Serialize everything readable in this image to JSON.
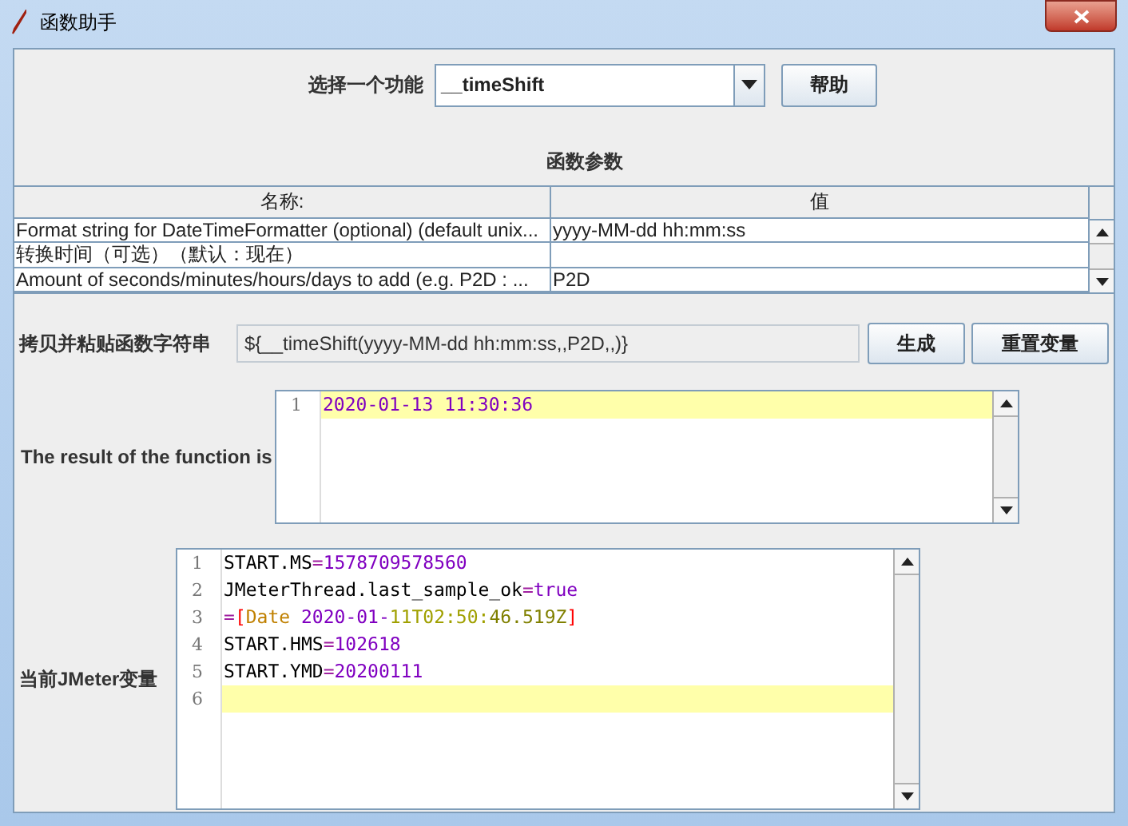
{
  "window": {
    "title": "函数助手"
  },
  "function_select": {
    "label": "选择一个功能",
    "value": "__timeShift",
    "help_button": "帮助"
  },
  "parameters": {
    "title": "函数参数",
    "columns": [
      "名称:",
      "值"
    ],
    "rows": [
      {
        "name": "Format string for DateTimeFormatter (optional) (default unix...",
        "value": "yyyy-MM-dd hh:mm:ss"
      },
      {
        "name": "转换时间（可选）（默认：现在）",
        "value": ""
      },
      {
        "name": "Amount of seconds/minutes/hours/days to add (e.g. P2D : ...",
        "value": "P2D"
      }
    ]
  },
  "copy_string": {
    "label": "拷贝并粘贴函数字符串",
    "value": "${__timeShift(yyyy-MM-dd hh:mm:ss,,P2D,,)}",
    "generate_button": "生成",
    "reset_button": "重置变量"
  },
  "result": {
    "label": "The result of the function is",
    "lines": [
      {
        "number": "1",
        "current": true,
        "tokens": [
          {
            "text": "2020-01-13 11:30:36",
            "color": "#8000c0"
          }
        ]
      }
    ]
  },
  "variables": {
    "label": "当前JMeter变量",
    "lines": [
      {
        "number": "1",
        "current": false,
        "tokens": [
          {
            "text": "START.MS",
            "color": "#000000"
          },
          {
            "text": "=",
            "color": "#a020a0"
          },
          {
            "text": "1578709578560",
            "color": "#8000c0"
          }
        ]
      },
      {
        "number": "2",
        "current": false,
        "tokens": [
          {
            "text": "JMeterThread.last_sample_ok",
            "color": "#000000"
          },
          {
            "text": "=",
            "color": "#a020a0"
          },
          {
            "text": "true",
            "color": "#8000c0"
          }
        ]
      },
      {
        "number": "3",
        "current": false,
        "tokens": [
          {
            "text": "=",
            "color": "#a020a0"
          },
          {
            "text": "[",
            "color": "#ff0000"
          },
          {
            "text": "Date ",
            "color": "#c08000"
          },
          {
            "text": "2020-01-",
            "color": "#8000c0"
          },
          {
            "text": "11T02:50:",
            "color": "#a0a000"
          },
          {
            "text": "46.519Z",
            "color": "#808000"
          },
          {
            "text": "]",
            "color": "#ff0000"
          }
        ]
      },
      {
        "number": "4",
        "current": false,
        "tokens": [
          {
            "text": "START.HMS",
            "color": "#000000"
          },
          {
            "text": "=",
            "color": "#a020a0"
          },
          {
            "text": "102618",
            "color": "#8000c0"
          }
        ]
      },
      {
        "number": "5",
        "current": false,
        "tokens": [
          {
            "text": "START.YMD",
            "color": "#000000"
          },
          {
            "text": "=",
            "color": "#a020a0"
          },
          {
            "text": "20200111",
            "color": "#8000c0"
          }
        ]
      },
      {
        "number": "6",
        "current": true
      }
    ]
  }
}
